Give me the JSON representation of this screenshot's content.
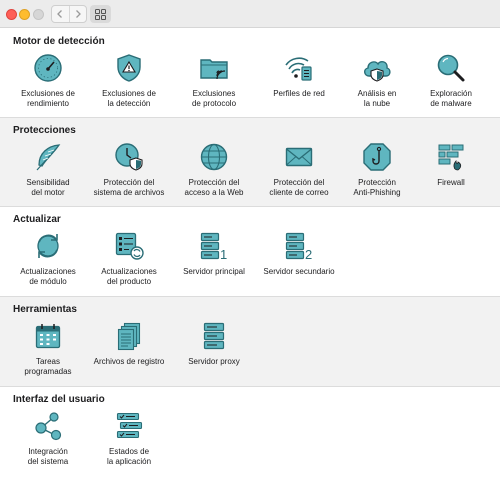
{
  "toolbar": {
    "back_icon": "chevron-left-icon",
    "forward_icon": "chevron-right-icon",
    "grid_icon": "grid-view-icon"
  },
  "colors": {
    "icon_fill": "#5fb6c0",
    "icon_stroke": "#2a6d76",
    "section_shade": "#f2f2f2"
  },
  "sections": [
    {
      "title": "Motor de detección",
      "items": [
        {
          "label": "Exclusiones de\nrendimiento",
          "icon": "gauge-icon"
        },
        {
          "label": "Exclusiones de\nla detección",
          "icon": "warning-shield-icon"
        },
        {
          "label": "Exclusiones\nde protocolo",
          "icon": "folder-signal-icon"
        },
        {
          "label": "Perfiles de red",
          "icon": "wifi-network-icon"
        },
        {
          "label": "Análisis en\nla nube",
          "icon": "cloud-shield-icon"
        },
        {
          "label": "Exploración\nde malware",
          "icon": "magnifier-icon"
        }
      ]
    },
    {
      "title": "Protecciones",
      "items": [
        {
          "label": "Sensibilidad\ndel motor",
          "icon": "feather-icon"
        },
        {
          "label": "Protección del\nsistema de archivos",
          "icon": "clock-shield-icon"
        },
        {
          "label": "Protección del\nacceso a la Web",
          "icon": "globe-icon"
        },
        {
          "label": "Protección del\ncliente de correo",
          "icon": "envelope-icon"
        },
        {
          "label": "Protección\nAnti-Phishing",
          "icon": "hook-icon"
        },
        {
          "label": "Firewall",
          "icon": "firewall-icon"
        }
      ]
    },
    {
      "title": "Actualizar",
      "items": [
        {
          "label": "Actualizaciones\nde módulo",
          "icon": "refresh-icon"
        },
        {
          "label": "Actualizaciones\ndel producto",
          "icon": "product-update-icon"
        },
        {
          "label": "Servidor principal",
          "icon": "server-primary-icon",
          "badge": "1"
        },
        {
          "label": "Servidor secundario",
          "icon": "server-secondary-icon",
          "badge": "2"
        }
      ]
    },
    {
      "title": "Herramientas",
      "items": [
        {
          "label": "Tareas\nprogramadas",
          "icon": "calendar-icon"
        },
        {
          "label": "Archivos de registro",
          "icon": "log-files-icon"
        },
        {
          "label": "Servidor proxy",
          "icon": "proxy-server-icon"
        }
      ]
    },
    {
      "title": "Interfaz del usuario",
      "items": [
        {
          "label": "Integración\ndel sistema",
          "icon": "network-nodes-icon"
        },
        {
          "label": "Estados de\nla aplicación",
          "icon": "app-states-icon"
        }
      ]
    }
  ]
}
